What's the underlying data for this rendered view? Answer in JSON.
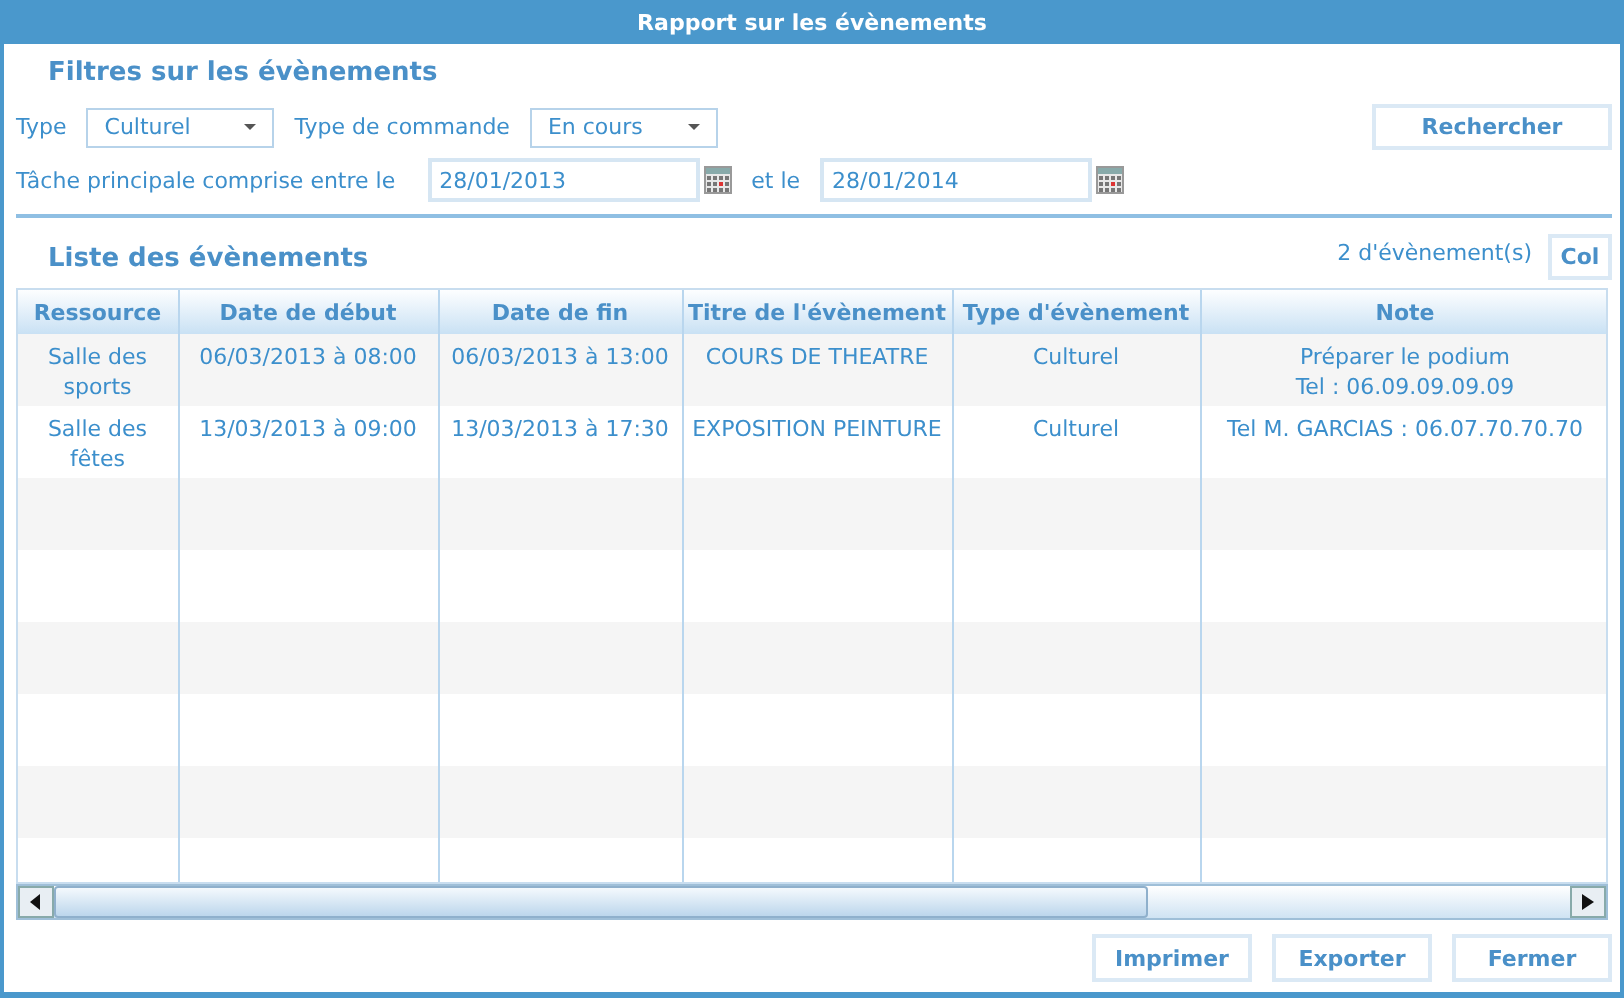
{
  "window": {
    "title": "Rapport sur les évènements"
  },
  "filters": {
    "title": "Filtres sur les évènements",
    "type_label": "Type",
    "type_value": "Culturel",
    "order_label": "Type de commande",
    "order_value": "En cours",
    "search_button": "Rechercher",
    "range_label": "Tâche principale comprise entre le",
    "from_date": "28/01/2013",
    "and_label": "et le",
    "to_date": "28/01/2014"
  },
  "list": {
    "title": "Liste des évènements",
    "count": "2 d'évènement(s)",
    "columns_button": "Col"
  },
  "table": {
    "columns": [
      "Ressource",
      "Date de début",
      "Date de fin",
      "Titre de l'évènement",
      "Type d'évènement",
      "Note"
    ],
    "rows": [
      [
        "Salle des sports",
        "06/03/2013 à 08:00",
        "06/03/2013 à 13:00",
        "COURS DE THEATRE",
        "Culturel",
        "Préparer le podium\nTel : 06.09.09.09.09"
      ],
      [
        "Salle des fêtes",
        "13/03/2013 à 09:00",
        "13/03/2013 à 17:30",
        "EXPOSITION PEINTURE",
        "Culturel",
        "Tel M. GARCIAS : 06.07.70.70.70"
      ]
    ]
  },
  "buttons": [
    "Imprimer",
    "Exporter",
    "Fermer"
  ]
}
